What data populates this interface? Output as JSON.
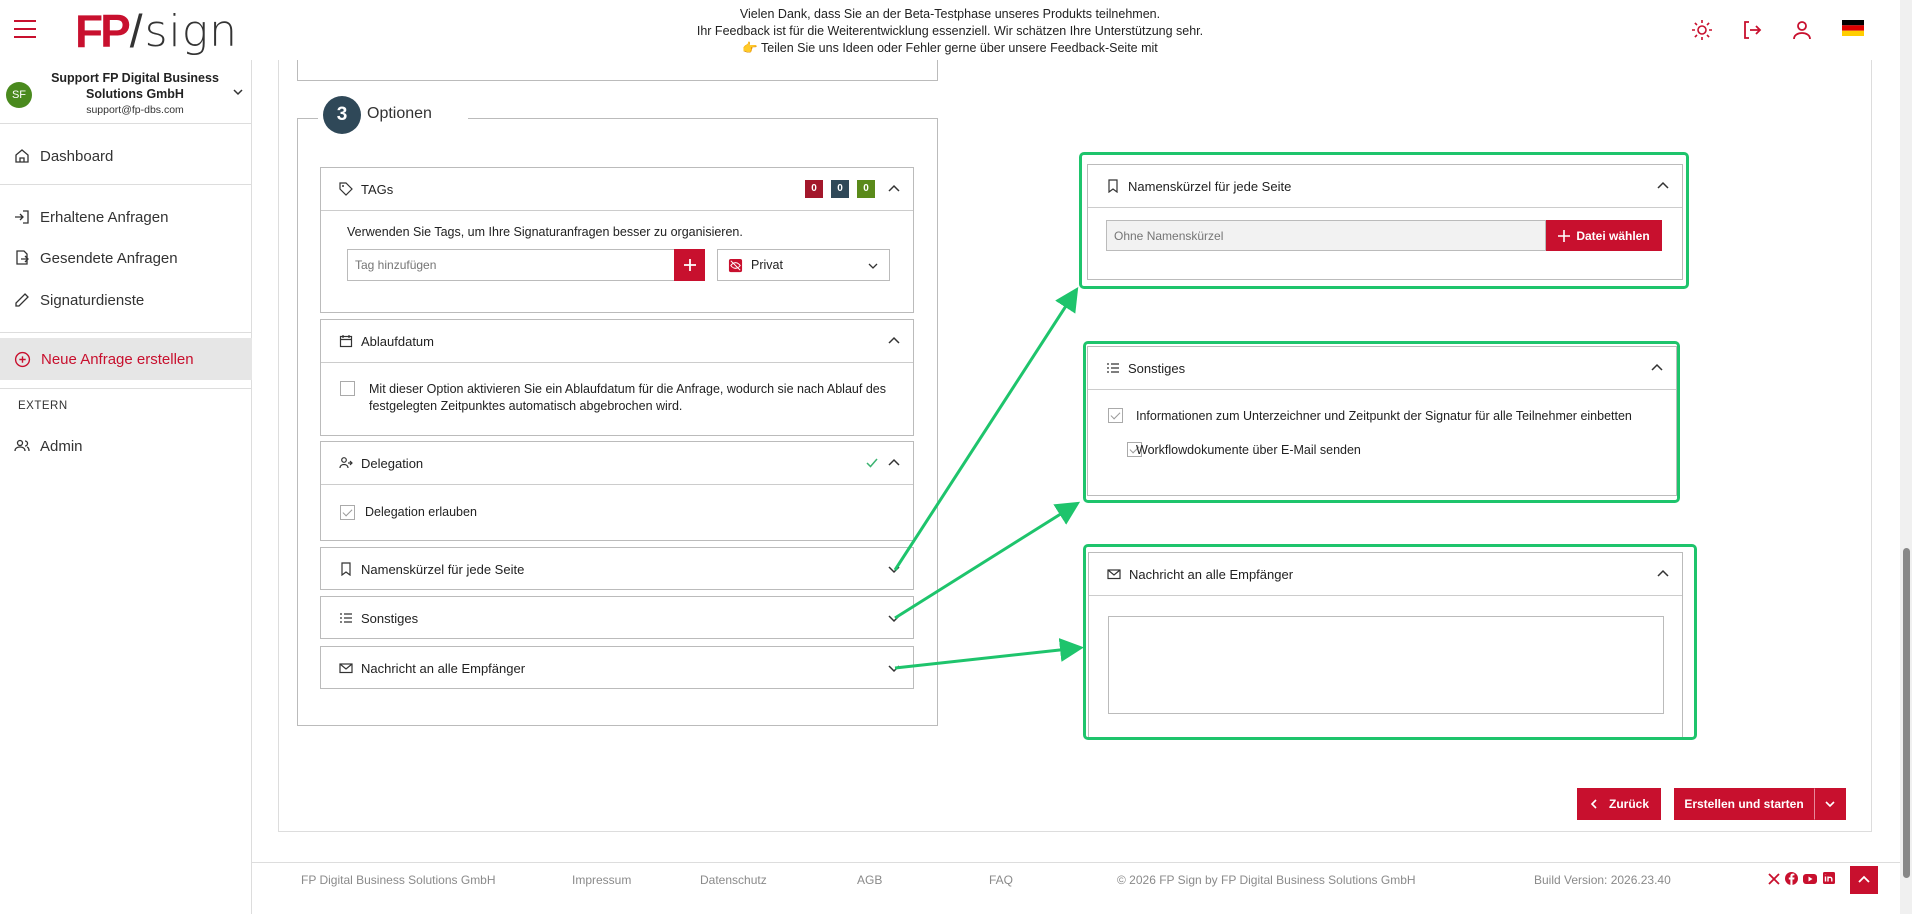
{
  "header": {
    "logo_fp": "FP",
    "logo_slash": "/",
    "logo_sign": "sign",
    "beta_line1": "Vielen Dank, dass Sie an der Beta-Testphase unseres Produkts teilnehmen.",
    "beta_line2": "Ihr Feedback ist für die Weiterentwicklung essenziell. Wir schätzen Ihre Unterstützung sehr.",
    "beta_line3": "👉 Teilen Sie uns Ideen oder Fehler gerne über unsere Feedback-Seite mit",
    "icons": [
      "menu-icon",
      "theme-sun-icon",
      "logout-icon",
      "user-icon",
      "german-flag-icon"
    ]
  },
  "sidebar": {
    "avatar": "SF",
    "user_name": "Support FP Digital Business Solutions GmbH",
    "user_mail": "support@fp-dbs.com",
    "items": [
      {
        "label": "Dashboard",
        "icon": "home-icon"
      },
      {
        "label": "Erhaltene Anfragen",
        "icon": "inbox-in-icon"
      },
      {
        "label": "Gesendete Anfragen",
        "icon": "sent-icon"
      },
      {
        "label": "Signaturdienste",
        "icon": "pen-icon"
      },
      {
        "label": "Neue Anfrage erstellen",
        "icon": "plus-circle-icon"
      }
    ],
    "section_extern": "EXTERN",
    "admin": {
      "label": "Admin",
      "icon": "users-icon"
    }
  },
  "options": {
    "step_number": "3",
    "step_title": "Optionen",
    "tags": {
      "title": "TAGs",
      "badges": [
        "0",
        "0",
        "0"
      ],
      "badge_colors": [
        "#a3172b",
        "#2f4858",
        "#5a8a1a"
      ],
      "hint": "Verwenden Sie Tags, um Ihre Signaturanfragen besser zu organisieren.",
      "input_placeholder": "Tag hinzufügen",
      "visibility": "Privat"
    },
    "expiry": {
      "title": "Ablaufdatum",
      "text": "Mit dieser Option aktivieren Sie ein Ablaufdatum für die Anfrage, wodurch sie nach Ablauf des festgelegten Zeitpunktes automatisch abgebrochen wird."
    },
    "delegation": {
      "title": "Delegation",
      "checkbox": "Delegation erlauben"
    },
    "initials": {
      "title": "Namenskürzel für jede Seite"
    },
    "misc": {
      "title": "Sonstiges"
    },
    "message": {
      "title": "Nachricht an alle Empfänger"
    }
  },
  "expanded": {
    "initials": {
      "title": "Namenskürzel für jede Seite",
      "input_placeholder": "Ohne Namenskürzel",
      "button": "Datei wählen"
    },
    "misc": {
      "title": "Sonstiges",
      "check1": "Informationen zum Unterzeichner und Zeitpunkt der Signatur für alle Teilnehmer einbetten",
      "check2": "Workflowdokumente über E-Mail senden"
    },
    "message": {
      "title": "Nachricht an alle Empfänger",
      "textarea_value": ""
    }
  },
  "actions": {
    "back": "Zurück",
    "create": "Erstellen und starten"
  },
  "footer": {
    "company": "FP Digital Business Solutions GmbH",
    "impressum": "Impressum",
    "datenschutz": "Datenschutz",
    "agb": "AGB",
    "faq": "FAQ",
    "copyright": "© 2026 FP Sign by FP Digital Business Solutions GmbH",
    "build": "Build Version: 2026.23.40",
    "social_icons": [
      "x-icon",
      "facebook-icon",
      "youtube-icon",
      "linkedin-icon"
    ]
  },
  "colors": {
    "brand_red": "#c8102e",
    "highlight_green": "#1ec46c",
    "step_circle": "#2f4858"
  }
}
